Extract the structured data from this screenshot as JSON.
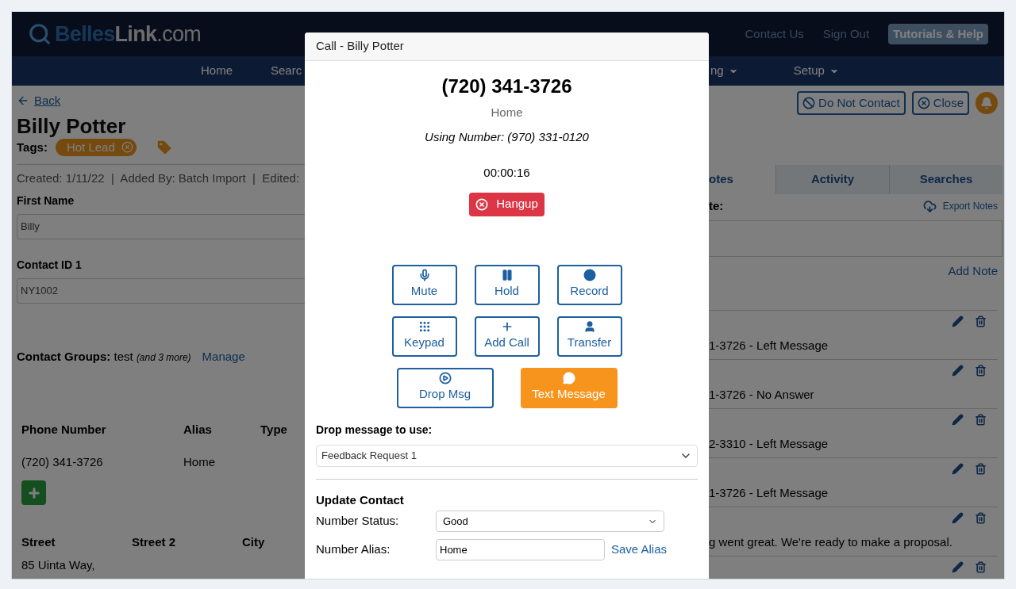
{
  "header": {
    "logo_main": "Belles",
    "logo_accent": "Link",
    "logo_suffix": ".com",
    "links": [
      "Contact Us",
      "Sign Out"
    ],
    "help_button": "Tutorials & Help"
  },
  "nav": [
    {
      "label": "Home",
      "dropdown": false
    },
    {
      "label": "Searc",
      "dropdown": false
    },
    {
      "label": "ng",
      "dropdown": true
    },
    {
      "label": "Setup",
      "dropdown": true
    }
  ],
  "contact": {
    "back": "Back",
    "name": "Billy Potter",
    "tags_label": "Tags:",
    "tags": [
      "Hot Lead"
    ],
    "meta": "Created: 1/11/22  |  Added By: Batch Import  |  Edited:",
    "fields": [
      {
        "label": "First Name",
        "value": "Billy"
      },
      {
        "label": "Contact ID 1",
        "value": "NY1002"
      }
    ],
    "groups": {
      "label": "Contact Groups:",
      "value": "test",
      "more": "(and 3 more)",
      "link": "Manage"
    },
    "phones": {
      "columns": [
        "Phone Number",
        "Alias",
        "Type"
      ],
      "rows": [
        [
          "(720) 341-3726",
          "Home"
        ]
      ]
    },
    "address": {
      "columns": [
        "Street",
        "Street 2",
        "City"
      ],
      "rows": [
        [
          "85 Uinta Way,"
        ]
      ]
    }
  },
  "actions": [
    {
      "label": "Do Not Contact",
      "kind": "ban"
    },
    {
      "label": "Close",
      "kind": "close"
    }
  ],
  "tabs": [
    {
      "label": "otes",
      "selected": true
    },
    {
      "label": "Activity",
      "selected": false
    },
    {
      "label": "Searches",
      "selected": false
    }
  ],
  "notes_panel": {
    "label": "te:",
    "export": "Export Notes",
    "add_note": "Add Note",
    "notes": [
      {
        "text": "1-3726 - Left Message"
      },
      {
        "text": "1-3726 - No Answer"
      },
      {
        "text": "2-3310 - Left Message"
      },
      {
        "text": "1-3726 - Left Message"
      },
      {
        "text": "g went great. We're ready to make a proposal."
      }
    ]
  },
  "dialog": {
    "title": "Call - Billy Potter",
    "number": "(720) 341-3726",
    "number_label": "Home",
    "using": "Using Number: (970) 331-0120",
    "timer": "00:00:16",
    "hangup": "Hangup",
    "controls": [
      [
        {
          "label": "Mute",
          "kind": "outline"
        },
        {
          "label": "Hold",
          "kind": "outline"
        },
        {
          "label": "Record",
          "kind": "outline"
        }
      ],
      [
        {
          "label": "Keypad",
          "kind": "outline"
        },
        {
          "label": "Add Call",
          "kind": "outline"
        },
        {
          "label": "Transfer",
          "kind": "outline"
        }
      ],
      [
        {
          "label": "Drop Msg",
          "kind": "outline"
        },
        {
          "label": "Text Message",
          "kind": "primary"
        }
      ]
    ],
    "drop_label": "Drop message to use:",
    "drop_value": "Feedback Request 1",
    "update_heading": "Update Contact",
    "status_label": "Number Status:",
    "status_value": "Good",
    "alias_label": "Number Alias:",
    "alias_value": "Home",
    "save_alias": "Save Alias"
  }
}
